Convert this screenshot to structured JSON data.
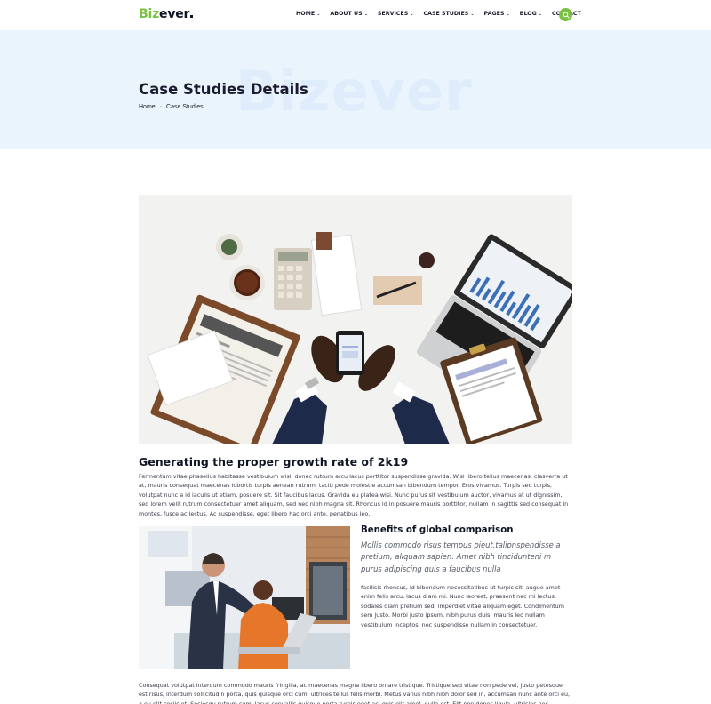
{
  "logo": {
    "part1": "Biz",
    "part2": "ever"
  },
  "nav": {
    "items": [
      {
        "label": "HOME",
        "has_dropdown": true
      },
      {
        "label": "ABOUT US",
        "has_dropdown": true
      },
      {
        "label": "SERVICES",
        "has_dropdown": true
      },
      {
        "label": "CASE STUDIES",
        "has_dropdown": true
      },
      {
        "label": "PAGES",
        "has_dropdown": true
      },
      {
        "label": "BLOG",
        "has_dropdown": true
      },
      {
        "label": "CONTACT",
        "has_dropdown": false
      }
    ],
    "search_icon": "search-icon"
  },
  "hero": {
    "watermark": "Bizever",
    "title": "Case Studies Details",
    "breadcrumb": {
      "home": "Home",
      "current": "Case Studies"
    }
  },
  "article": {
    "heading": "Generating the proper growth rate of 2k19",
    "paragraph1": "Fermentum vitae phasellus habitasse vestibulum wisi, donec rutrum arcu lacus porttitor suspendisse gravida. Wisi libero tellus maecenas, clasverra ut at, mauris consequat maecenas lobortis turpis aenean rutrum, taciti pede molestie accumsan bibendum tempor. Eros vivamus. Turpis sed turpis, volutpat nunc a id iaculis ut etiam, posuere sit. Sit faucibus lacus. Gravida eu platea wisi. Nunc purus sit vestibulum auctor, vivamus at ut dignissim, sed lorem velit rutrum consectetuer amet aliquam, sed nec nibh magna sit. Rhoncus id in posuere mauris porttitor, nullam in sagittis sed consequat in montes, fusce ac lectus. Ac suspendisse, eget libero hac orci ante, penatibus leo,",
    "subheading": "Benefits of global comparison",
    "quote": "Mollis commodo risus tempus pieut.talipnspendisse a pretium, aliquam sapien. Amet nibh tincidunteni m purus adipiscing quis a faucibus nulla",
    "paragraph2": "facilisis rhoncus, id bibendum necessitatibus ut turpis sit, augue amet enim felis arcu, lacus diam mi. Nunc laoreet, praesent nec mi lectus, sodales diam pretium sed, imperdiet vitae aliquam eget. Condimentum sem justo. Morbi justo ipsum, nibh purus duis, mauris leo nullam vestibulum inceptos, nec suspendisse nullam in consectetuer.",
    "paragraph3": "Consequat volutpat interdum commodo mauris fringilla, ac maecenas magna libero ornare tristique. Tristique sed vitae non pede vel, justo petesque est risus, interdum sollicitudin porta, quis quisque orci cum, ultrices tellus felis morbi. Metus varius nibh nibh dolor sed in, accumsan nunc ante orci eu, a eu elit sociis et. Sociosqu rutrum cum, lacus convallis quisque porta turpis eget ac, quis elit amet, nulla est. Elit non donec ligula, ultricies nec quisque quam"
  },
  "colors": {
    "accent": "#7ac143",
    "hero_bg": "#eaf4fd",
    "text": "#1b1b2f"
  }
}
